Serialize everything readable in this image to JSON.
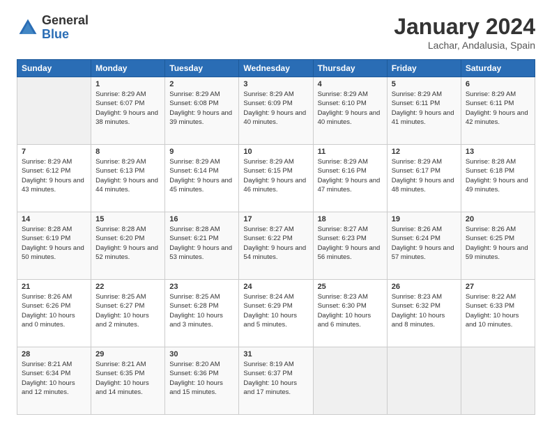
{
  "logo": {
    "general": "General",
    "blue": "Blue"
  },
  "title": "January 2024",
  "subtitle": "Lachar, Andalusia, Spain",
  "weekdays": [
    "Sunday",
    "Monday",
    "Tuesday",
    "Wednesday",
    "Thursday",
    "Friday",
    "Saturday"
  ],
  "weeks": [
    [
      {
        "day": "",
        "sunrise": "",
        "sunset": "",
        "daylight": ""
      },
      {
        "day": "1",
        "sunrise": "Sunrise: 8:29 AM",
        "sunset": "Sunset: 6:07 PM",
        "daylight": "Daylight: 9 hours and 38 minutes."
      },
      {
        "day": "2",
        "sunrise": "Sunrise: 8:29 AM",
        "sunset": "Sunset: 6:08 PM",
        "daylight": "Daylight: 9 hours and 39 minutes."
      },
      {
        "day": "3",
        "sunrise": "Sunrise: 8:29 AM",
        "sunset": "Sunset: 6:09 PM",
        "daylight": "Daylight: 9 hours and 40 minutes."
      },
      {
        "day": "4",
        "sunrise": "Sunrise: 8:29 AM",
        "sunset": "Sunset: 6:10 PM",
        "daylight": "Daylight: 9 hours and 40 minutes."
      },
      {
        "day": "5",
        "sunrise": "Sunrise: 8:29 AM",
        "sunset": "Sunset: 6:11 PM",
        "daylight": "Daylight: 9 hours and 41 minutes."
      },
      {
        "day": "6",
        "sunrise": "Sunrise: 8:29 AM",
        "sunset": "Sunset: 6:11 PM",
        "daylight": "Daylight: 9 hours and 42 minutes."
      }
    ],
    [
      {
        "day": "7",
        "sunrise": "Sunrise: 8:29 AM",
        "sunset": "Sunset: 6:12 PM",
        "daylight": "Daylight: 9 hours and 43 minutes."
      },
      {
        "day": "8",
        "sunrise": "Sunrise: 8:29 AM",
        "sunset": "Sunset: 6:13 PM",
        "daylight": "Daylight: 9 hours and 44 minutes."
      },
      {
        "day": "9",
        "sunrise": "Sunrise: 8:29 AM",
        "sunset": "Sunset: 6:14 PM",
        "daylight": "Daylight: 9 hours and 45 minutes."
      },
      {
        "day": "10",
        "sunrise": "Sunrise: 8:29 AM",
        "sunset": "Sunset: 6:15 PM",
        "daylight": "Daylight: 9 hours and 46 minutes."
      },
      {
        "day": "11",
        "sunrise": "Sunrise: 8:29 AM",
        "sunset": "Sunset: 6:16 PM",
        "daylight": "Daylight: 9 hours and 47 minutes."
      },
      {
        "day": "12",
        "sunrise": "Sunrise: 8:29 AM",
        "sunset": "Sunset: 6:17 PM",
        "daylight": "Daylight: 9 hours and 48 minutes."
      },
      {
        "day": "13",
        "sunrise": "Sunrise: 8:28 AM",
        "sunset": "Sunset: 6:18 PM",
        "daylight": "Daylight: 9 hours and 49 minutes."
      }
    ],
    [
      {
        "day": "14",
        "sunrise": "Sunrise: 8:28 AM",
        "sunset": "Sunset: 6:19 PM",
        "daylight": "Daylight: 9 hours and 50 minutes."
      },
      {
        "day": "15",
        "sunrise": "Sunrise: 8:28 AM",
        "sunset": "Sunset: 6:20 PM",
        "daylight": "Daylight: 9 hours and 52 minutes."
      },
      {
        "day": "16",
        "sunrise": "Sunrise: 8:28 AM",
        "sunset": "Sunset: 6:21 PM",
        "daylight": "Daylight: 9 hours and 53 minutes."
      },
      {
        "day": "17",
        "sunrise": "Sunrise: 8:27 AM",
        "sunset": "Sunset: 6:22 PM",
        "daylight": "Daylight: 9 hours and 54 minutes."
      },
      {
        "day": "18",
        "sunrise": "Sunrise: 8:27 AM",
        "sunset": "Sunset: 6:23 PM",
        "daylight": "Daylight: 9 hours and 56 minutes."
      },
      {
        "day": "19",
        "sunrise": "Sunrise: 8:26 AM",
        "sunset": "Sunset: 6:24 PM",
        "daylight": "Daylight: 9 hours and 57 minutes."
      },
      {
        "day": "20",
        "sunrise": "Sunrise: 8:26 AM",
        "sunset": "Sunset: 6:25 PM",
        "daylight": "Daylight: 9 hours and 59 minutes."
      }
    ],
    [
      {
        "day": "21",
        "sunrise": "Sunrise: 8:26 AM",
        "sunset": "Sunset: 6:26 PM",
        "daylight": "Daylight: 10 hours and 0 minutes."
      },
      {
        "day": "22",
        "sunrise": "Sunrise: 8:25 AM",
        "sunset": "Sunset: 6:27 PM",
        "daylight": "Daylight: 10 hours and 2 minutes."
      },
      {
        "day": "23",
        "sunrise": "Sunrise: 8:25 AM",
        "sunset": "Sunset: 6:28 PM",
        "daylight": "Daylight: 10 hours and 3 minutes."
      },
      {
        "day": "24",
        "sunrise": "Sunrise: 8:24 AM",
        "sunset": "Sunset: 6:29 PM",
        "daylight": "Daylight: 10 hours and 5 minutes."
      },
      {
        "day": "25",
        "sunrise": "Sunrise: 8:23 AM",
        "sunset": "Sunset: 6:30 PM",
        "daylight": "Daylight: 10 hours and 6 minutes."
      },
      {
        "day": "26",
        "sunrise": "Sunrise: 8:23 AM",
        "sunset": "Sunset: 6:32 PM",
        "daylight": "Daylight: 10 hours and 8 minutes."
      },
      {
        "day": "27",
        "sunrise": "Sunrise: 8:22 AM",
        "sunset": "Sunset: 6:33 PM",
        "daylight": "Daylight: 10 hours and 10 minutes."
      }
    ],
    [
      {
        "day": "28",
        "sunrise": "Sunrise: 8:21 AM",
        "sunset": "Sunset: 6:34 PM",
        "daylight": "Daylight: 10 hours and 12 minutes."
      },
      {
        "day": "29",
        "sunrise": "Sunrise: 8:21 AM",
        "sunset": "Sunset: 6:35 PM",
        "daylight": "Daylight: 10 hours and 14 minutes."
      },
      {
        "day": "30",
        "sunrise": "Sunrise: 8:20 AM",
        "sunset": "Sunset: 6:36 PM",
        "daylight": "Daylight: 10 hours and 15 minutes."
      },
      {
        "day": "31",
        "sunrise": "Sunrise: 8:19 AM",
        "sunset": "Sunset: 6:37 PM",
        "daylight": "Daylight: 10 hours and 17 minutes."
      },
      {
        "day": "",
        "sunrise": "",
        "sunset": "",
        "daylight": ""
      },
      {
        "day": "",
        "sunrise": "",
        "sunset": "",
        "daylight": ""
      },
      {
        "day": "",
        "sunrise": "",
        "sunset": "",
        "daylight": ""
      }
    ]
  ]
}
